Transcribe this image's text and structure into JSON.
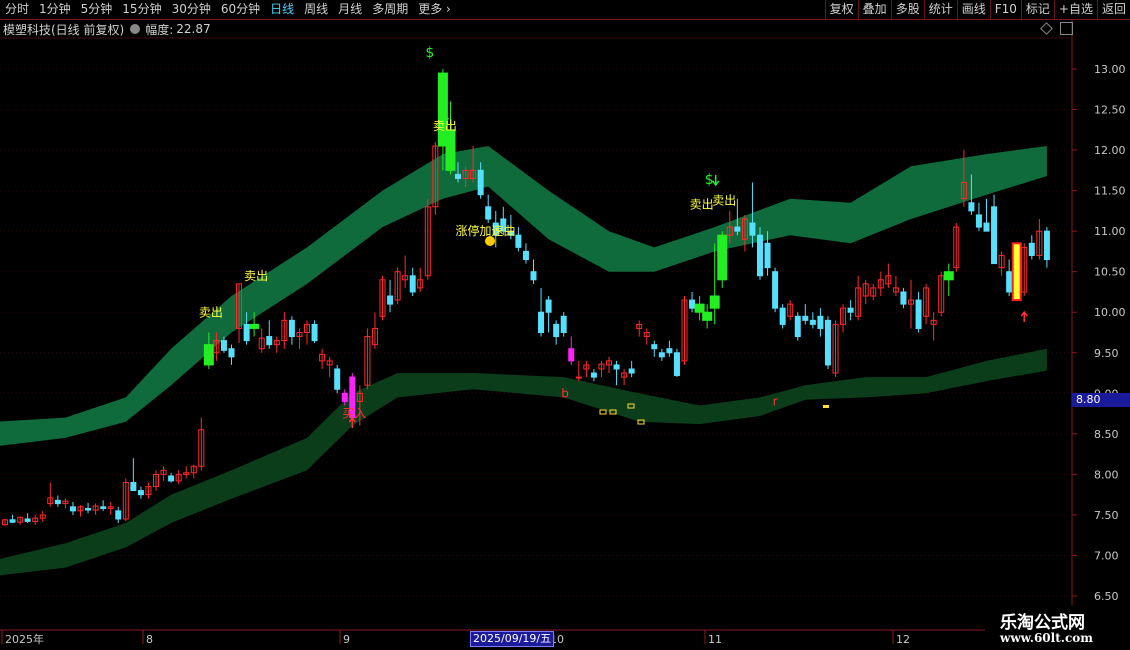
{
  "toolbar": {
    "periods": [
      "分时",
      "1分钟",
      "5分钟",
      "15分钟",
      "30分钟",
      "60分钟",
      "日线",
      "周线",
      "月线",
      "多周期",
      "更多"
    ],
    "active_period": "日线",
    "right_buttons": [
      "复权",
      "叠加",
      "多股",
      "统计",
      "画线",
      "F10",
      "标记",
      "+自选",
      "返回"
    ]
  },
  "info": {
    "title": "模塑科技(日线 前复权)",
    "amplitude_label": "幅度:",
    "amplitude_value": "22.87"
  },
  "price_box": "8.80",
  "date_box": "2025/09/19/五",
  "watermark": {
    "line1": "乐淘公式网",
    "line2": "www.60lt.com"
  },
  "colors": {
    "up": "#ff2a2a",
    "down": "#55e0ff",
    "band_upper": "#0f6b3c",
    "band_lower": "#0b3d1a",
    "signal_green": "#22ee22",
    "signal_magenta": "#ff22ff",
    "text_yellow": "#ffff44"
  },
  "chart_data": {
    "type": "candlestick",
    "ylim": [
      6.5,
      13.25
    ],
    "y_ticks": [
      "6.50",
      "7.00",
      "7.50",
      "8.00",
      "8.50",
      "9.00",
      "9.50",
      "10.00",
      "10.50",
      "11.00",
      "11.50",
      "12.00",
      "12.50",
      "13.00"
    ],
    "x_labels": [
      "2025年",
      "8",
      "9",
      "10",
      "11",
      "12"
    ],
    "candles": [
      [
        7.38,
        7.45,
        7.36,
        7.44
      ],
      [
        7.44,
        7.5,
        7.4,
        7.41
      ],
      [
        7.41,
        7.48,
        7.38,
        7.47
      ],
      [
        7.45,
        7.52,
        7.4,
        7.42
      ],
      [
        7.42,
        7.5,
        7.38,
        7.46
      ],
      [
        7.46,
        7.55,
        7.42,
        7.5
      ],
      [
        7.64,
        7.9,
        7.6,
        7.71
      ],
      [
        7.68,
        7.74,
        7.6,
        7.64
      ],
      [
        7.64,
        7.7,
        7.58,
        7.67
      ],
      [
        7.6,
        7.66,
        7.5,
        7.55
      ],
      [
        7.55,
        7.62,
        7.48,
        7.6
      ],
      [
        7.58,
        7.65,
        7.52,
        7.56
      ],
      [
        7.56,
        7.64,
        7.5,
        7.61
      ],
      [
        7.6,
        7.68,
        7.55,
        7.58
      ],
      [
        7.58,
        7.66,
        7.5,
        7.6
      ],
      [
        7.55,
        7.6,
        7.4,
        7.45
      ],
      [
        7.45,
        7.95,
        7.42,
        7.9
      ],
      [
        7.9,
        8.2,
        7.8,
        7.8
      ],
      [
        7.8,
        7.85,
        7.7,
        7.75
      ],
      [
        7.75,
        7.9,
        7.7,
        7.85
      ],
      [
        7.85,
        8.05,
        7.8,
        8.0
      ],
      [
        8.0,
        8.1,
        7.92,
        8.05
      ],
      [
        7.98,
        8.02,
        7.9,
        7.92
      ],
      [
        7.92,
        8.05,
        7.88,
        8.0
      ],
      [
        8.0,
        8.1,
        7.95,
        8.02
      ],
      [
        8.02,
        8.12,
        7.95,
        8.1
      ],
      [
        8.1,
        8.7,
        8.05,
        8.55
      ],
      [
        9.35,
        9.75,
        9.3,
        9.6
      ],
      [
        9.5,
        9.75,
        9.4,
        9.65
      ],
      [
        9.65,
        9.7,
        9.5,
        9.53
      ],
      [
        9.55,
        9.6,
        9.35,
        9.45
      ],
      [
        9.8,
        10.35,
        9.62,
        10.35
      ],
      [
        9.85,
        10.0,
        9.6,
        9.65
      ],
      [
        9.85,
        10.0,
        9.7,
        9.8
      ],
      [
        9.55,
        9.8,
        9.5,
        9.68
      ],
      [
        9.7,
        9.9,
        9.55,
        9.6
      ],
      [
        9.6,
        9.7,
        9.5,
        9.65
      ],
      [
        9.65,
        10.0,
        9.55,
        9.9
      ],
      [
        9.9,
        9.95,
        9.6,
        9.7
      ],
      [
        9.7,
        9.8,
        9.55,
        9.75
      ],
      [
        9.75,
        9.9,
        9.6,
        9.85
      ],
      [
        9.85,
        9.9,
        9.62,
        9.65
      ],
      [
        9.4,
        9.55,
        9.3,
        9.48
      ],
      [
        9.35,
        9.45,
        9.2,
        9.4
      ],
      [
        9.3,
        9.35,
        9.0,
        9.05
      ],
      [
        8.9,
        9.05,
        8.85,
        9.0
      ],
      [
        9.2,
        9.25,
        8.65,
        8.7
      ],
      [
        8.9,
        9.1,
        8.6,
        9.0
      ],
      [
        9.1,
        9.8,
        9.05,
        9.7
      ],
      [
        9.6,
        10.0,
        9.55,
        9.8
      ],
      [
        9.95,
        10.45,
        9.9,
        10.4
      ],
      [
        10.2,
        10.4,
        10.0,
        10.1
      ],
      [
        10.15,
        10.55,
        10.1,
        10.5
      ],
      [
        10.4,
        10.7,
        10.3,
        10.45
      ],
      [
        10.45,
        10.55,
        10.2,
        10.25
      ],
      [
        10.3,
        10.55,
        10.25,
        10.4
      ],
      [
        10.45,
        11.4,
        10.4,
        11.3
      ],
      [
        11.3,
        12.1,
        11.2,
        12.05
      ],
      [
        12.05,
        13.0,
        11.75,
        12.95
      ],
      [
        12.25,
        12.6,
        11.7,
        11.75
      ],
      [
        11.7,
        11.85,
        11.6,
        11.65
      ],
      [
        11.65,
        11.8,
        11.55,
        11.75
      ],
      [
        11.65,
        12.05,
        11.6,
        11.75
      ],
      [
        11.75,
        11.85,
        11.4,
        11.45
      ],
      [
        11.3,
        11.45,
        11.1,
        11.15
      ],
      [
        11.1,
        11.25,
        10.8,
        10.95
      ],
      [
        11.15,
        11.3,
        10.95,
        11.0
      ],
      [
        11.0,
        11.2,
        10.9,
        10.95
      ],
      [
        10.95,
        11.05,
        10.75,
        10.8
      ],
      [
        10.75,
        10.85,
        10.6,
        10.65
      ],
      [
        10.5,
        10.65,
        10.35,
        10.4
      ],
      [
        10.0,
        10.3,
        9.7,
        9.75
      ],
      [
        10.15,
        10.2,
        9.75,
        10.0
      ],
      [
        9.85,
        9.9,
        9.6,
        9.7
      ],
      [
        9.95,
        10.0,
        9.7,
        9.75
      ],
      [
        9.55,
        9.7,
        9.35,
        9.4
      ],
      [
        9.2,
        9.4,
        9.15,
        9.2
      ],
      [
        9.3,
        9.4,
        9.2,
        9.35
      ],
      [
        9.25,
        9.3,
        9.15,
        9.2
      ],
      [
        9.3,
        9.4,
        9.2,
        9.36
      ],
      [
        9.35,
        9.45,
        9.25,
        9.4
      ],
      [
        9.35,
        9.4,
        9.1,
        9.3
      ],
      [
        9.2,
        9.3,
        9.1,
        9.25
      ],
      [
        9.3,
        9.4,
        9.2,
        9.25
      ],
      [
        9.8,
        9.9,
        9.7,
        9.85
      ],
      [
        9.7,
        9.8,
        9.6,
        9.75
      ],
      [
        9.6,
        9.65,
        9.45,
        9.55
      ],
      [
        9.5,
        9.55,
        9.4,
        9.45
      ],
      [
        9.55,
        9.65,
        9.45,
        9.5
      ],
      [
        9.5,
        9.55,
        9.2,
        9.22
      ],
      [
        9.4,
        10.2,
        9.35,
        10.15
      ],
      [
        10.15,
        10.25,
        10.0,
        10.05
      ],
      [
        10.0,
        10.2,
        9.9,
        10.1
      ],
      [
        10.0,
        10.1,
        9.8,
        9.9
      ],
      [
        10.05,
        10.85,
        9.85,
        10.2
      ],
      [
        10.4,
        11.0,
        10.3,
        10.95
      ],
      [
        10.95,
        11.25,
        10.85,
        11.05
      ],
      [
        11.05,
        11.4,
        10.95,
        11.0
      ],
      [
        10.9,
        11.2,
        10.75,
        11.15
      ],
      [
        11.1,
        11.6,
        10.8,
        10.95
      ],
      [
        10.95,
        11.05,
        10.4,
        10.45
      ],
      [
        10.85,
        11.0,
        10.45,
        10.55
      ],
      [
        10.5,
        10.55,
        10.0,
        10.05
      ],
      [
        10.05,
        10.1,
        9.8,
        9.85
      ],
      [
        9.95,
        10.15,
        9.9,
        10.1
      ],
      [
        9.95,
        10.0,
        9.65,
        9.7
      ],
      [
        9.95,
        10.1,
        9.85,
        9.9
      ],
      [
        9.9,
        10.0,
        9.8,
        9.85
      ],
      [
        9.95,
        10.05,
        9.7,
        9.8
      ],
      [
        9.9,
        9.95,
        9.3,
        9.35
      ],
      [
        9.25,
        9.9,
        9.2,
        9.85
      ],
      [
        9.85,
        10.1,
        9.75,
        10.05
      ],
      [
        10.05,
        10.15,
        9.9,
        10.0
      ],
      [
        9.95,
        10.45,
        9.9,
        10.3
      ],
      [
        10.2,
        10.4,
        10.1,
        10.35
      ],
      [
        10.2,
        10.35,
        10.15,
        10.3
      ],
      [
        10.3,
        10.5,
        10.2,
        10.4
      ],
      [
        10.35,
        10.6,
        10.3,
        10.45
      ],
      [
        10.25,
        10.45,
        10.2,
        10.3
      ],
      [
        10.25,
        10.3,
        10.05,
        10.1
      ],
      [
        10.1,
        10.4,
        9.8,
        10.15
      ],
      [
        10.15,
        10.25,
        9.75,
        9.8
      ],
      [
        9.95,
        10.35,
        9.85,
        10.3
      ],
      [
        9.85,
        10.0,
        9.65,
        9.9
      ],
      [
        10.0,
        10.5,
        9.95,
        10.45
      ],
      [
        10.4,
        10.6,
        10.2,
        10.5
      ],
      [
        10.55,
        11.1,
        10.5,
        11.05
      ],
      [
        11.4,
        12.0,
        11.3,
        11.6
      ],
      [
        11.35,
        11.7,
        11.2,
        11.25
      ],
      [
        11.2,
        11.35,
        11.0,
        11.05
      ],
      [
        11.1,
        11.4,
        11.0,
        11.0
      ],
      [
        11.3,
        11.45,
        10.6,
        10.6
      ],
      [
        10.55,
        10.75,
        10.45,
        10.7
      ],
      [
        10.5,
        10.65,
        10.2,
        10.25
      ],
      [
        10.25,
        10.4,
        10.15,
        10.2
      ],
      [
        10.25,
        10.85,
        10.2,
        10.8
      ],
      [
        10.85,
        10.95,
        10.65,
        10.7
      ],
      [
        10.7,
        11.15,
        10.65,
        11.0
      ],
      [
        11.0,
        11.05,
        10.55,
        10.65
      ]
    ],
    "markers": [
      {
        "type": "text",
        "text": "卖出",
        "i": 27,
        "y": 9.95
      },
      {
        "type": "text",
        "text": "卖出",
        "i": 33,
        "y": 10.4
      },
      {
        "type": "text",
        "text": "买入",
        "i": 46,
        "y": 8.7
      },
      {
        "type": "text",
        "text": "卖出",
        "i": 58,
        "y": 12.25
      },
      {
        "type": "text",
        "text": "涨停加速曲",
        "i": 61,
        "y": 10.95
      },
      {
        "type": "text",
        "text": "卖出",
        "i": 92,
        "y": 11.28
      },
      {
        "type": "text",
        "text": "卖出",
        "i": 95,
        "y": 11.33
      },
      {
        "type": "text",
        "text": "$",
        "i": 57,
        "y": 13.15
      },
      {
        "type": "text",
        "text": "$",
        "i": 94,
        "y": 11.58
      },
      {
        "type": "text",
        "text": "b",
        "i": 75,
        "y": 8.95
      },
      {
        "type": "text",
        "text": "r",
        "i": 103,
        "y": 8.85
      }
    ]
  }
}
